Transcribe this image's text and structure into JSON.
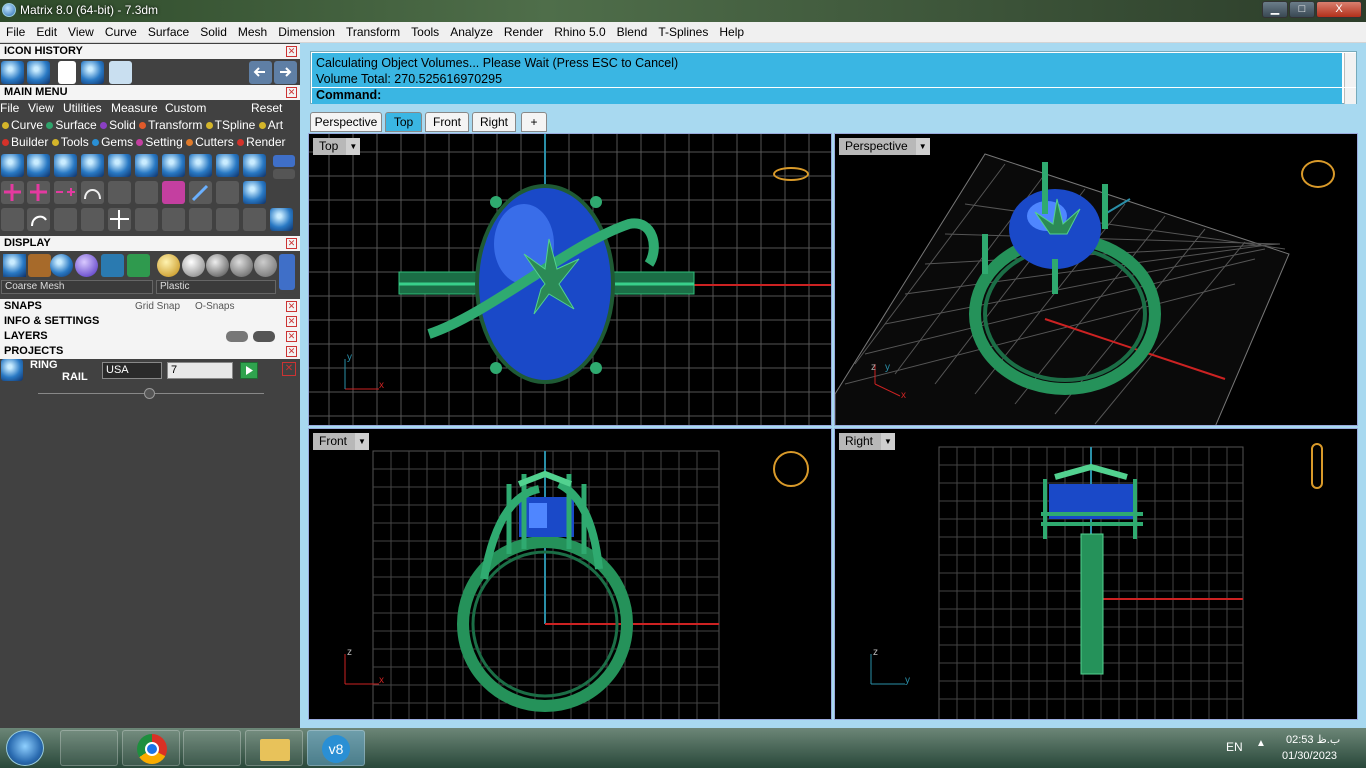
{
  "window": {
    "title": "Matrix 8.0 (64-bit) - 7.3dm",
    "min": "▁",
    "max": "□",
    "close": "X"
  },
  "menu": [
    "File",
    "Edit",
    "View",
    "Curve",
    "Surface",
    "Solid",
    "Mesh",
    "Dimension",
    "Transform",
    "Tools",
    "Analyze",
    "Render",
    "Rhino 5.0",
    "Blend",
    "T-Splines",
    "Help"
  ],
  "panels": {
    "icon_history": "ICON HISTORY",
    "main_menu": "MAIN MENU",
    "main_menu_items": [
      "File",
      "View",
      "Utilities",
      "Measure",
      "Custom",
      "Reset"
    ],
    "categories_row1": [
      {
        "label": "Curve",
        "color": "#d4b52a"
      },
      {
        "label": "Surface",
        "color": "#2fa36b"
      },
      {
        "label": "Solid",
        "color": "#8a3fc4"
      },
      {
        "label": "Transform",
        "color": "#e05a2a"
      },
      {
        "label": "TSpline",
        "color": "#d4b52a"
      },
      {
        "label": "Art",
        "color": "#d4b52a"
      }
    ],
    "categories_row2": [
      {
        "label": "Builder",
        "color": "#d4322a"
      },
      {
        "label": "Tools",
        "color": "#d4b52a"
      },
      {
        "label": "Gems",
        "color": "#2a8fd4"
      },
      {
        "label": "Setting",
        "color": "#c43fa0"
      },
      {
        "label": "Cutters",
        "color": "#e07a2a"
      },
      {
        "label": "Render",
        "color": "#d4322a"
      }
    ],
    "display": "DISPLAY",
    "mesh_quality": "Coarse Mesh",
    "material": "Plastic",
    "snaps": "SNAPS",
    "grid_snap": "Grid Snap",
    "o_snaps": "O-Snaps",
    "info": "INFO & SETTINGS",
    "layers": "LAYERS",
    "projects": "PROJECTS",
    "ring_label": "RING",
    "rail_label": "RAIL",
    "ring_standard": "USA",
    "ring_size": "7"
  },
  "command": {
    "line1": "Calculating Object Volumes... Please Wait (Press ESC to Cancel)",
    "line2": "Volume Total: 270.525616970295",
    "prompt": "Command:"
  },
  "tabs": [
    "Perspective",
    "Top",
    "Front",
    "Right",
    "+"
  ],
  "active_tab": "Top",
  "viewports": {
    "top": {
      "label": "Top",
      "axis_x": "x",
      "axis_y": "y"
    },
    "perspective": {
      "label": "Perspective",
      "axis_x": "x",
      "axis_y": "y",
      "axis_z": "z"
    },
    "front": {
      "label": "Front",
      "axis_x": "x",
      "axis_z": "z"
    },
    "right": {
      "label": "Right",
      "axis_y": "y",
      "axis_z": "z"
    }
  },
  "colors": {
    "gem": "#1a4fd0",
    "metal": "#1f8a5a",
    "grid": "#555555",
    "axis_x": "#cc2222",
    "axis_y": "#2a8fa8"
  },
  "taskbar": {
    "lang": "EN",
    "time": "02:53 ب.ظ",
    "date": "01/30/2023"
  }
}
